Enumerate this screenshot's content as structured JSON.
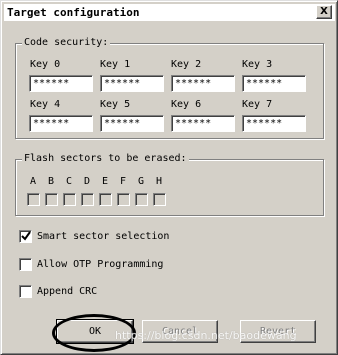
{
  "window": {
    "title": "Target configuration",
    "close_label": "X"
  },
  "code_security": {
    "label": "Code security:",
    "keys": [
      {
        "label": "Key 0",
        "value": "******"
      },
      {
        "label": "Key 1",
        "value": "******"
      },
      {
        "label": "Key 2",
        "value": "******"
      },
      {
        "label": "Key 3",
        "value": "******"
      },
      {
        "label": "Key 4",
        "value": "******"
      },
      {
        "label": "Key 5",
        "value": "******"
      },
      {
        "label": "Key 6",
        "value": "******"
      },
      {
        "label": "Key 7",
        "value": "******"
      }
    ]
  },
  "flash_sectors": {
    "label": "Flash sectors to be erased:",
    "sectors": [
      "A",
      "B",
      "C",
      "D",
      "E",
      "F",
      "G",
      "H"
    ]
  },
  "options": [
    {
      "label": "Smart sector selection",
      "checked": true
    },
    {
      "label": "Allow OTP Programming",
      "checked": false
    },
    {
      "label": "Append CRC",
      "checked": false
    }
  ],
  "buttons": {
    "ok": "OK",
    "cancel": "Cancel",
    "revert": "Revert"
  },
  "watermark": "https://blog.csdn.net/baodewang",
  "colors": {
    "dialog_background": "#d4d0c8",
    "title_background": "#ffffff"
  }
}
